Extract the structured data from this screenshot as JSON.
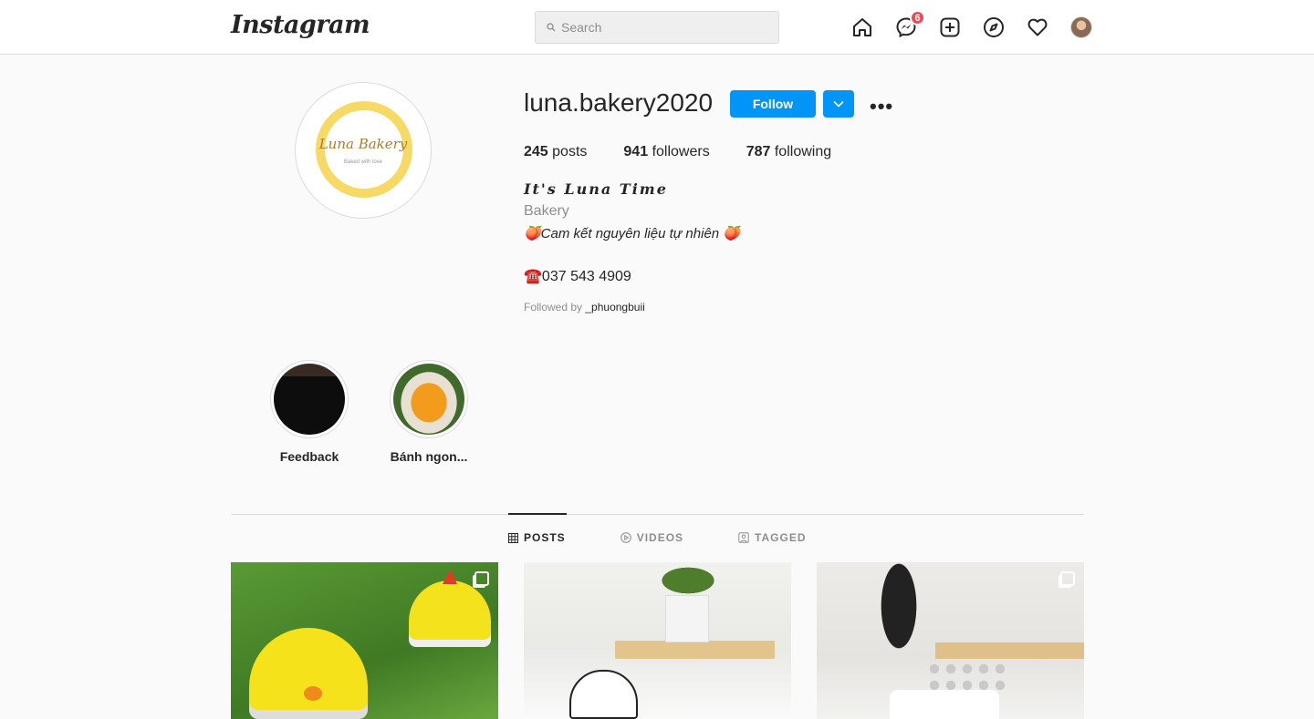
{
  "header": {
    "logo": "Instagram",
    "search_placeholder": "Search",
    "messenger_badge": "6"
  },
  "profile": {
    "avatar_title": "Luna Bakery",
    "avatar_sub": "Baked with love",
    "username": "luna.bakery2020",
    "follow_label": "Follow",
    "more_label": "•••",
    "stats": {
      "posts_count": "245",
      "posts_label": "posts",
      "followers_count": "941",
      "followers_label": "followers",
      "following_count": "787",
      "following_label": "following"
    },
    "bio_line1": "It's Luna Time",
    "bio_category": "Bakery",
    "bio_line3": "🍑Cam kết nguyên liệu tự nhiên 🍑",
    "bio_phone": "☎️037 543 4909",
    "followed_prefix": "Followed by ",
    "followed_user": "_phuongbuii"
  },
  "highlights": [
    {
      "label": "Feedback"
    },
    {
      "label": "Bánh ngon..."
    }
  ],
  "tabs": [
    {
      "label": "POSTS",
      "icon": "grid-icon",
      "active": true
    },
    {
      "label": "VIDEOS",
      "icon": "play-icon",
      "active": false
    },
    {
      "label": "TAGGED",
      "icon": "tag-icon",
      "active": false
    }
  ],
  "colors": {
    "accent": "#0095f6",
    "badge": "#ed4956"
  }
}
